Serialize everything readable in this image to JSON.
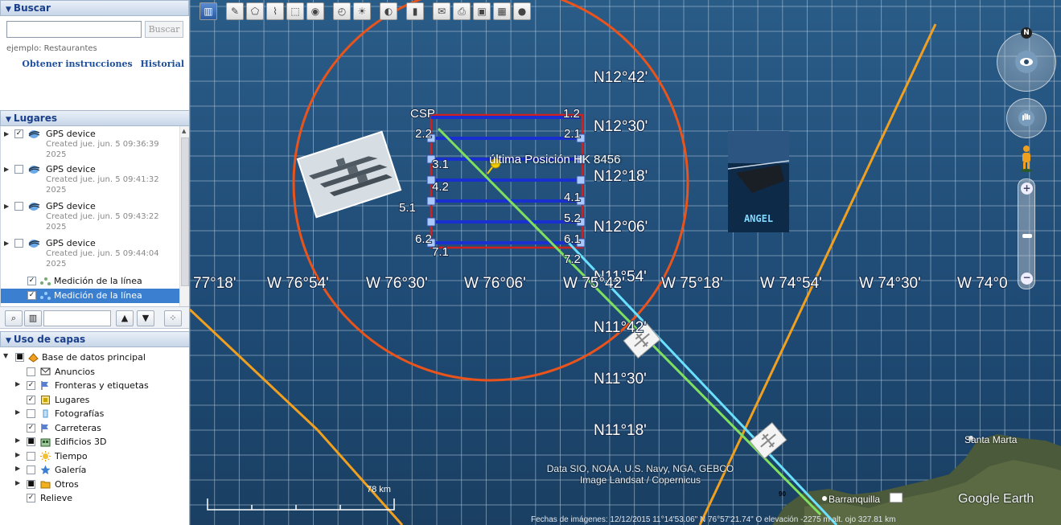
{
  "search": {
    "header": "Buscar",
    "input_value": "",
    "button": "Buscar",
    "hint": "ejemplo: Restaurantes",
    "link_directions": "Obtener instrucciones",
    "link_history": "Historial"
  },
  "places": {
    "header": "Lugares",
    "items": [
      {
        "title": "GPS device",
        "sub": "Created jue. jun. 5 09:36:39 2025",
        "checked": "✓"
      },
      {
        "title": "GPS device",
        "sub": "Created jue. jun. 5 09:41:32 2025",
        "checked": ""
      },
      {
        "title": "GPS device",
        "sub": "Created jue. jun. 5 09:43:22 2025",
        "checked": ""
      },
      {
        "title": "GPS device",
        "sub": "Created jue. jun. 5 09:44:04 2025",
        "checked": ""
      }
    ],
    "measure_1": "Medición de la línea",
    "measure_2": "Medición de la línea"
  },
  "layers": {
    "header": "Uso de capas",
    "items": [
      {
        "label": "Base de datos principal",
        "check": "■",
        "icon": "database-icon",
        "color": "#f0a020"
      },
      {
        "label": "Anuncios",
        "check": "",
        "icon": "message-icon",
        "color": "#333"
      },
      {
        "label": "Fronteras y etiquetas",
        "check": "✓",
        "icon": "flag-icon",
        "color": "#5a7fd0"
      },
      {
        "label": "Lugares",
        "check": "✓",
        "icon": "place-square-icon",
        "color": "#c8a800"
      },
      {
        "label": "Fotografías",
        "check": "",
        "icon": "photo-icon",
        "color": "#4a9ad8"
      },
      {
        "label": "Carreteras",
        "check": "✓",
        "icon": "road-flag-icon",
        "color": "#5a7fd0"
      },
      {
        "label": "Edificios 3D",
        "check": "■",
        "icon": "building-icon",
        "color": "#4a8a4a"
      },
      {
        "label": "Tiempo",
        "check": "",
        "icon": "sun-icon",
        "color": "#e8a010"
      },
      {
        "label": "Galería",
        "check": "",
        "icon": "star-icon",
        "color": "#3a7fd0"
      },
      {
        "label": "Otros",
        "check": "■",
        "icon": "folder-icon",
        "color": "#f0b020"
      },
      {
        "label": "Relieve",
        "check": "✓",
        "icon": "",
        "color": ""
      }
    ]
  },
  "map": {
    "lat_labels": [
      "N12°42'",
      "N12°30'",
      "N12°18'",
      "N12°06'",
      "N11°54'",
      "N11°42'",
      "N11°30'",
      "N11°18'"
    ],
    "lon_labels": [
      "77°18'",
      "W 76°54'",
      "W 76°30'",
      "W 76°06'",
      "W 75°42'",
      "W 75°18'",
      "W 74°54'",
      "W 74°30'",
      "W 74°0"
    ],
    "sar_labels": [
      "CSP",
      "1.2",
      "2.2",
      "2.1",
      "3.1",
      "4.2",
      "4.1",
      "5.1",
      "5.2",
      "6.2",
      "6.1",
      "7.1",
      "7.2"
    ],
    "position_label": "última Posición HK 8456",
    "city_1": "Santa Marta",
    "city_2": "Barranquilla",
    "road_badge": "90",
    "attribution_1": "Data SIO, NOAA, U.S. Navy, NGA, GEBCO",
    "attribution_2": "Image Landsat / Copernicus",
    "brand": "Google Earth",
    "scale": "78 km",
    "status": "Fechas de imágenes: 12/12/2015     11°14'53.06\" N    76°57'21.74\" O   elevación  -2275 m      alt. ojo 327.81 km",
    "nav_north": "N",
    "poster_text": "ANGEL",
    "colors": {
      "ring": "#e8541c",
      "sar_box": "#d02020",
      "sar_line": "#1a2fd0",
      "green_line": "#7fe060",
      "cyan_line": "#6ae0ff",
      "orange_line": "#f0a020"
    }
  }
}
